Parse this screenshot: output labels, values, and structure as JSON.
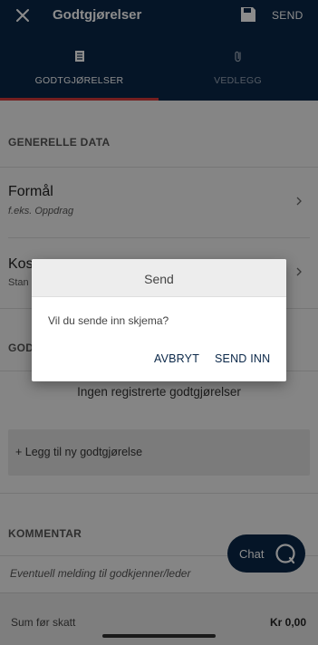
{
  "header": {
    "title": "Godtgjørelser",
    "send_label": "SEND"
  },
  "tabs": [
    {
      "label": "GODTGJØRELSER"
    },
    {
      "label": "VEDLEGG"
    }
  ],
  "general": {
    "header": "GENERELLE DATA",
    "purpose": {
      "label": "Formål",
      "placeholder": "f.eks. Oppdrag"
    },
    "cost": {
      "label": "Kos",
      "value": "Stan"
    }
  },
  "allowances": {
    "header": "GOD",
    "empty": "Ingen registrerte godtgjørelser",
    "add_label": "+ Legg til ny godtgjørelse"
  },
  "comment": {
    "header": "KOMMENTAR",
    "placeholder": "Eventuell melding til godkjenner/leder"
  },
  "footer": {
    "label": "Sum før skatt",
    "value": "Kr 0,00"
  },
  "chat": {
    "label": "Chat"
  },
  "dialog": {
    "title": "Send",
    "message": "Vil du sende inn skjema?",
    "cancel": "AVBRYT",
    "confirm": "SEND INN"
  },
  "colors": {
    "primary": "#0a2748",
    "accent": "#d63b3b"
  }
}
